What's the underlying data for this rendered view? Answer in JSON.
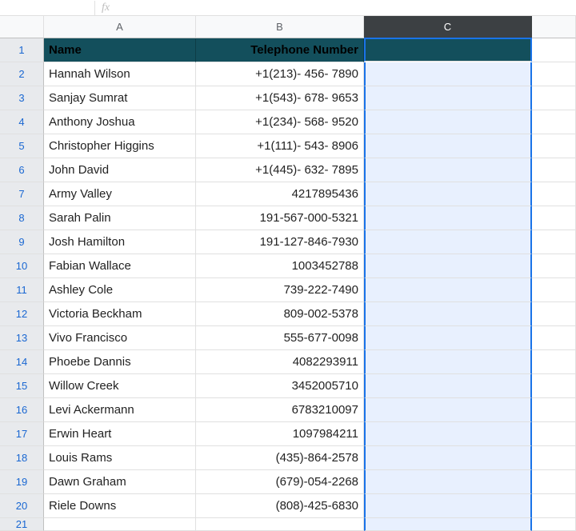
{
  "fx_label": "fx",
  "columns": [
    "A",
    "B",
    "C"
  ],
  "selected_column_index": 2,
  "headers": {
    "name": "Name",
    "phone": "Telephone Number",
    "c": ""
  },
  "rows": [
    {
      "n": 1
    },
    {
      "n": 2,
      "name": "Hannah Wilson",
      "phone": "+1(213)- 456- 7890"
    },
    {
      "n": 3,
      "name": "Sanjay Sumrat",
      "phone": "+1(543)- 678- 9653"
    },
    {
      "n": 4,
      "name": "Anthony Joshua",
      "phone": "+1(234)- 568- 9520"
    },
    {
      "n": 5,
      "name": "Christopher Higgins",
      "phone": "+1(111)- 543- 8906"
    },
    {
      "n": 6,
      "name": "John David",
      "phone": "+1(445)- 632- 7895"
    },
    {
      "n": 7,
      "name": "Army Valley",
      "phone": "4217895436"
    },
    {
      "n": 8,
      "name": "Sarah Palin",
      "phone": "191-567-000-5321"
    },
    {
      "n": 9,
      "name": "Josh Hamilton",
      "phone": "191-127-846-7930"
    },
    {
      "n": 10,
      "name": "Fabian Wallace",
      "phone": "1003452788"
    },
    {
      "n": 11,
      "name": "Ashley Cole",
      "phone": "739-222-7490"
    },
    {
      "n": 12,
      "name": "Victoria Beckham",
      "phone": "809-002-5378"
    },
    {
      "n": 13,
      "name": "Vivo Francisco",
      "phone": "555-677-0098"
    },
    {
      "n": 14,
      "name": "Phoebe Dannis",
      "phone": "4082293911"
    },
    {
      "n": 15,
      "name": "Willow Creek",
      "phone": "3452005710"
    },
    {
      "n": 16,
      "name": "Levi Ackermann",
      "phone": "6783210097"
    },
    {
      "n": 17,
      "name": "Erwin Heart",
      "phone": "1097984211"
    },
    {
      "n": 18,
      "name": "Louis Rams",
      "phone": "(435)-864-2578"
    },
    {
      "n": 19,
      "name": "Dawn Graham",
      "phone": "(679)-054-2268"
    },
    {
      "n": 20,
      "name": "Riele Downs",
      "phone": "(808)-425-6830"
    },
    {
      "n": 21,
      "name": "",
      "phone": ""
    }
  ]
}
